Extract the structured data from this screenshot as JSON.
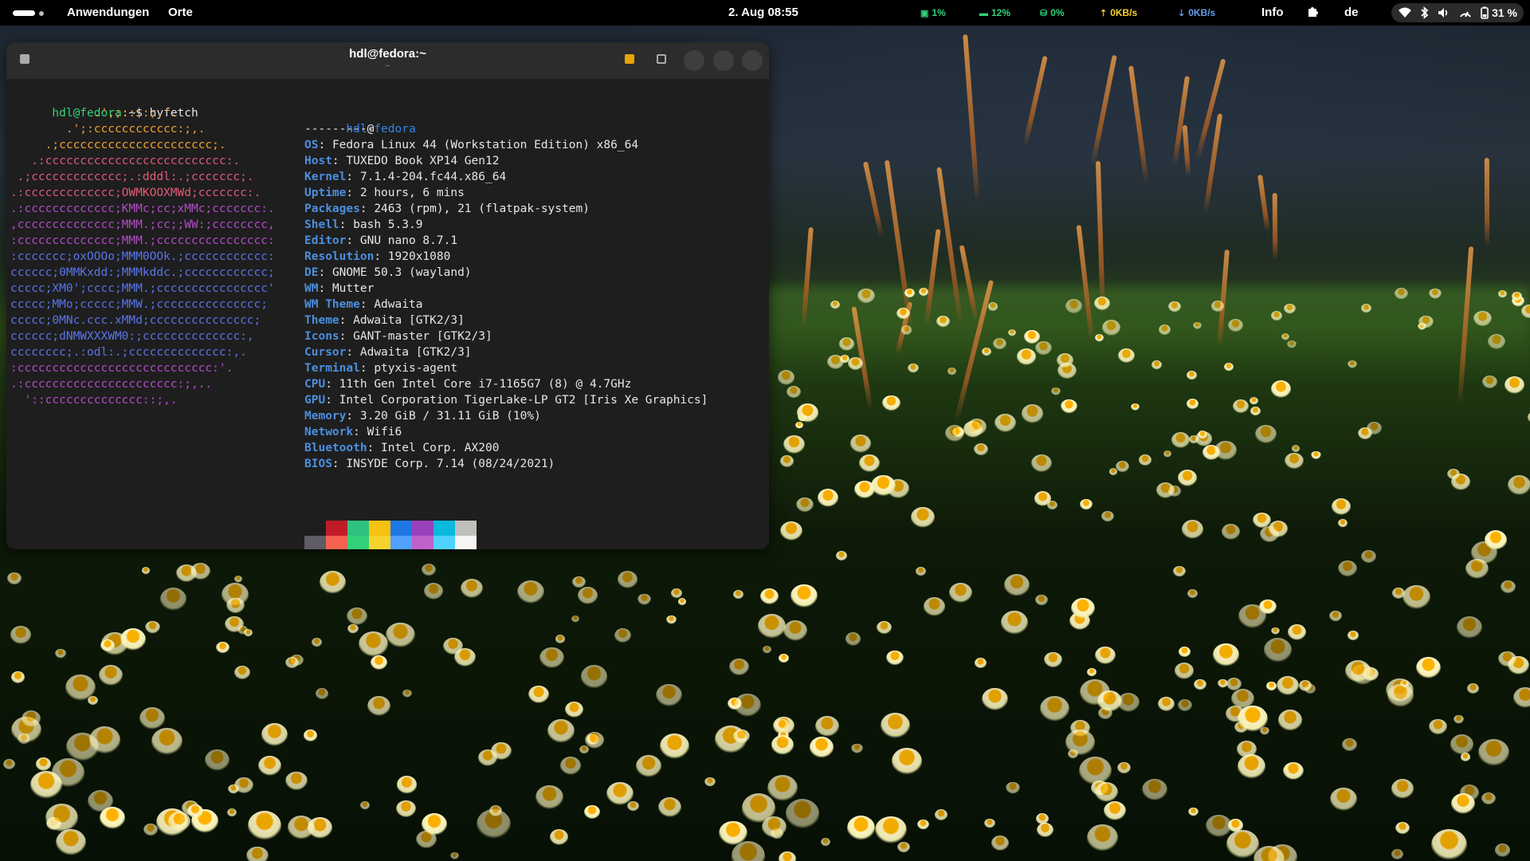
{
  "topbar": {
    "activities": "Activities",
    "applications": "Anwendungen",
    "places": "Orte",
    "clock": "2. Aug 08:55",
    "stats": [
      {
        "icon": "cpu-icon",
        "value": "1%"
      },
      {
        "icon": "memory-icon",
        "value": "12%"
      },
      {
        "icon": "disk-icon",
        "value": "0%"
      },
      {
        "icon": "upload-icon",
        "value": "0KB/s"
      },
      {
        "icon": "download-icon",
        "value": "0KB/s"
      }
    ],
    "info": "Info",
    "keyboard": "de",
    "battery": "31 %"
  },
  "terminal": {
    "title": "hdl@fedora:~",
    "subtitle": "~",
    "prompt_user": "hdl@fedora",
    "prompt_path": ":~$",
    "command": "hyfetch",
    "logo": [
      "            .',;::::;,'.",
      "        .';:cccccccccccc:;,.",
      "     .;cccccccccccccccccccccc;.",
      "   .:cccccccccccccccccccccccccc:.",
      " .;ccccccccccccc;.:dddl:.;ccccccc;.",
      ".:ccccccccccccc;OWMKOOXMWd;ccccccc:.",
      ".:ccccccccccccc;KMMc;cc;xMMc;ccccccc:.",
      ",cccccccccccccc;MMM.;cc;;WW:;cccccccc,",
      ":cccccccccccccc;MMM.;cccccccccccccccc:",
      ":ccccccc;oxOOOo;MMM0OOk.;cccccccccccc:",
      "cccccc;0MMKxdd:;MMMkddc.;cccccccccccc;",
      "ccccc;XM0';cccc;MMM.;cccccccccccccccc'",
      "ccccc;MMo;ccccc;MMW.;ccccccccccccccc;",
      "ccccc;0MNc.ccc.xMMd;ccccccccccccccc;",
      "cccccc;dNMWXXXWM0:;cccccccccccccc:,",
      "cccccccc;.:odl:.;cccccccccccccc:,.",
      ":cccccccccccccccccccccccccccc:'.",
      ".:cccccccccccccccccccccc:;,..",
      "  '::cccccccccccccc::;,."
    ],
    "info_header_user": "hdl",
    "info_header_at": "@",
    "info_header_host": "fedora",
    "separator": "----------",
    "info": [
      {
        "key": "OS",
        "value": "Fedora Linux 44 (Workstation Edition) x86_64"
      },
      {
        "key": "Host",
        "value": "TUXEDO Book XP14 Gen12"
      },
      {
        "key": "Kernel",
        "value": "7.1.4-204.fc44.x86_64"
      },
      {
        "key": "Uptime",
        "value": "2 hours, 6 mins"
      },
      {
        "key": "Packages",
        "value": "2463 (rpm), 21 (flatpak-system)"
      },
      {
        "key": "Shell",
        "value": "bash 5.3.9"
      },
      {
        "key": "Editor",
        "value": "GNU nano 8.7.1"
      },
      {
        "key": "Resolution",
        "value": "1920x1080"
      },
      {
        "key": "DE",
        "value": "GNOME 50.3 (wayland)"
      },
      {
        "key": "WM",
        "value": "Mutter"
      },
      {
        "key": "WM Theme",
        "value": "Adwaita"
      },
      {
        "key": "Theme",
        "value": "Adwaita [GTK2/3]"
      },
      {
        "key": "Icons",
        "value": "GANT-master [GTK2/3]"
      },
      {
        "key": "Cursor",
        "value": "Adwaita [GTK2/3]"
      },
      {
        "key": "Terminal",
        "value": "ptyxis-agent"
      },
      {
        "key": "CPU",
        "value": "11th Gen Intel Core i7-1165G7 (8) @ 4.7GHz"
      },
      {
        "key": "GPU",
        "value": "Intel Corporation TigerLake-LP GT2 [Iris Xe Graphics]"
      },
      {
        "key": "Memory",
        "value": "3.20 GiB / 31.11 GiB (10%)"
      },
      {
        "key": "Network",
        "value": "Wifi6"
      },
      {
        "key": "Bluetooth",
        "value": "Intel Corp. AX200"
      },
      {
        "key": "BIOS",
        "value": "INSYDE Corp. 7.14 (08/24/2021)"
      }
    ],
    "palette": [
      [
        "#1d1d1d",
        "#5e5c64"
      ],
      [
        "#c01c28",
        "#f66151"
      ],
      [
        "#2ec27e",
        "#33d17a"
      ],
      [
        "#f5c211",
        "#f6d32d"
      ],
      [
        "#1e78e4",
        "#51a1ff"
      ],
      [
        "#9841bb",
        "#c061cb"
      ],
      [
        "#0ab9dc",
        "#4fd2fd"
      ],
      [
        "#c0bfbc",
        "#f6f5f4"
      ]
    ],
    "logo_colors": {
      "top": "#f0a030",
      "mid": "#e05a7a",
      "purple": "#b24cc8",
      "blue": "#5a74e8"
    }
  }
}
